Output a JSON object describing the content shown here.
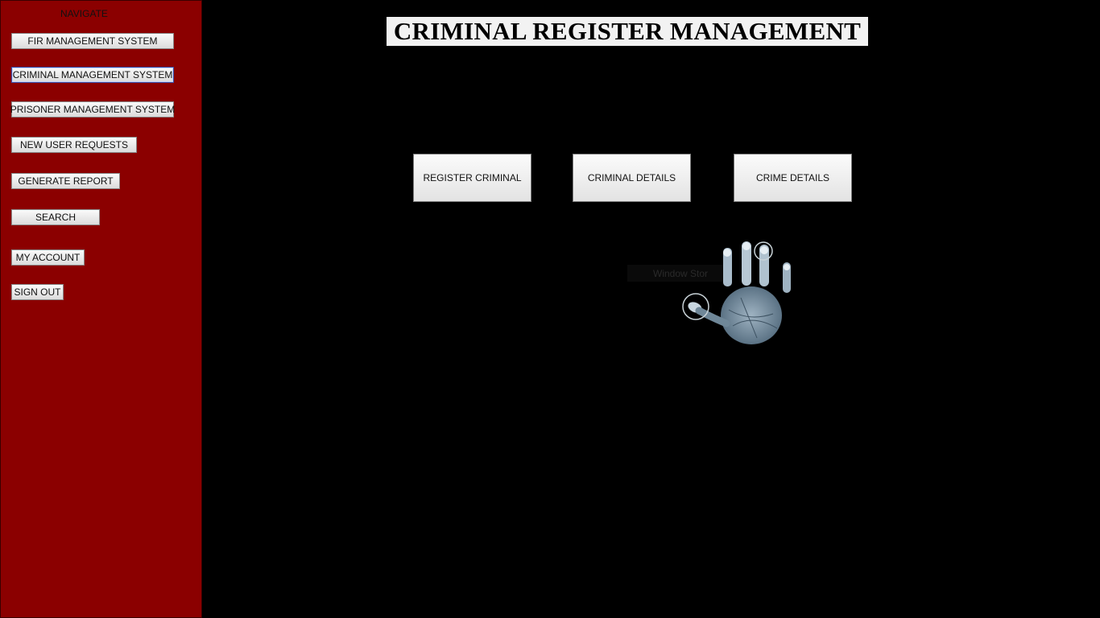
{
  "sidebar": {
    "heading": "NAVIGATE",
    "items": [
      {
        "label": "FIR MANAGEMENT SYSTEM"
      },
      {
        "label": "CRIMINAL MANAGEMENT SYSTEM"
      },
      {
        "label": "PRISONER MANAGEMENT SYSTEM"
      },
      {
        "label": "NEW USER REQUESTS"
      },
      {
        "label": "GENERATE REPORT"
      },
      {
        "label": "SEARCH"
      },
      {
        "label": "MY ACCOUNT"
      },
      {
        "label": "SIGN OUT"
      }
    ],
    "background": "#8b0000"
  },
  "main": {
    "title": "CRIMINAL REGISTER MANAGEMENT",
    "buttons": [
      {
        "label": "REGISTER CRIMINAL"
      },
      {
        "label": "CRIMINAL DETAILS"
      },
      {
        "label": "CRIME DETAILS"
      }
    ],
    "background": "#000000",
    "decoration": {
      "icon": "handprint-icon",
      "faint_label": "Window Stor"
    }
  }
}
